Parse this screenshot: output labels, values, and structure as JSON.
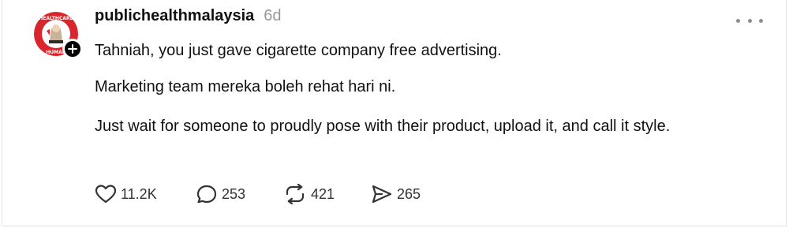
{
  "post": {
    "username": "publichealthmalaysia",
    "time_ago": "6d",
    "avatar_logo_text": "HEALTHCARE HUMAN",
    "paragraphs": [
      "Tahniah, you just gave cigarette company free advertising.",
      "Marketing team mereka boleh rehat hari ni.",
      "Just wait for someone to proudly pose with their product, upload it, and call it style."
    ]
  },
  "actions": {
    "likes": "11.2K",
    "replies": "253",
    "reposts": "421",
    "shares": "265"
  },
  "icons": {
    "like": "heart-icon",
    "reply": "comment-bubble-icon",
    "repost": "repost-icon",
    "share": "send-icon",
    "more": "more-dots-icon",
    "follow": "plus-icon"
  },
  "colors": {
    "text": "#111111",
    "muted": "#999999",
    "logo_red": "#d9262d",
    "badge": "#000000"
  }
}
